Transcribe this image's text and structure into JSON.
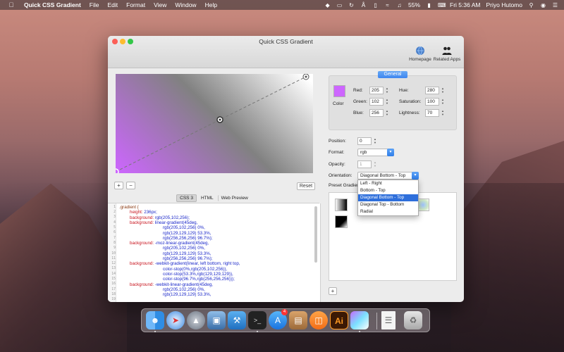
{
  "menubar": {
    "apple_icon": "apple-icon",
    "app_name": "Quick CSS Gradient",
    "menus": [
      "File",
      "Edit",
      "Format",
      "View",
      "Window",
      "Help"
    ],
    "battery": "55%",
    "clock": "Fri 5:36 AM",
    "user": "Priyo Hutomo"
  },
  "window": {
    "title": "Quick CSS Gradient",
    "toolbar": {
      "homepage_label": "Homepage",
      "related_label": "Related Apps"
    }
  },
  "editor": {
    "add_stop": "+",
    "remove_stop": "−",
    "reset": "Reset",
    "tabs": [
      "CSS 3",
      "HTML",
      "Web Preview"
    ],
    "active_tab": "CSS 3",
    "line_numbers": [
      "1",
      "2",
      "3",
      "4",
      "5",
      "6",
      "7",
      "8",
      "9",
      "10",
      "11",
      "12",
      "13",
      "14",
      "15",
      "16",
      "17",
      "18",
      "19"
    ],
    "code": [
      {
        "sel": ".gradient {"
      },
      {
        "prop": "height:",
        "val": " 236px;"
      },
      {
        "prop": "background:",
        "val": " rgb(205,102,256);"
      },
      {
        "prop": "background:",
        "val": " linear-gradient(45deg,"
      },
      {
        "val": "rgb(205,102,256) 0%,"
      },
      {
        "val": "rgb(129,129,129) 53.3%,"
      },
      {
        "val": "rgb(256,256,256) 96.7%);"
      },
      {
        "prop": "background:",
        "val": " -moz-linear-gradient(45deg,"
      },
      {
        "val": "rgb(205,102,256) 0%,"
      },
      {
        "val": "rgb(129,129,129) 53.3%,"
      },
      {
        "val": "rgb(256,256,256) 96.7%);"
      },
      {
        "prop": "background:",
        "val": " -webkit-gradient(linear, left bottom, right top,"
      },
      {
        "val": "color-stop(0%,rgb(205,102,256)),"
      },
      {
        "val": "color-stop(53.3%,rgb(129,129,129)),"
      },
      {
        "val": "color-stop(96.7%,rgb(256,256,256)));"
      },
      {
        "prop": "background:",
        "val": " -webkit-linear-gradient(45deg,"
      },
      {
        "val": "rgb(205,102,256) 0%,"
      },
      {
        "val": "rgb(129,129,129) 53.3%,"
      },
      {
        "val": ""
      }
    ]
  },
  "general": {
    "tab_label": "General",
    "color_label": "Color",
    "swatch_color": "#cd66ff",
    "red_label": "Red:",
    "red": "205",
    "green_label": "Green:",
    "green": "102",
    "blue_label": "Blue:",
    "blue": "256",
    "hue_label": "Hue:",
    "hue": "280",
    "saturation_label": "Saturation:",
    "saturation": "100",
    "lightness_label": "Lightness:",
    "lightness": "70"
  },
  "settings": {
    "position_label": "Position:",
    "position": "0",
    "format_label": "Format:",
    "format": "rgb",
    "opacity_label": "Opacity:",
    "opacity": "1",
    "orientation_label": "Orientation:",
    "orientation": "Diagonal Bottom - Top",
    "orientation_options": [
      "Left - Right",
      "Bottom - Top",
      "Diagonal Bottom - Top",
      "Diagonal Top - Bottom",
      "Radial"
    ],
    "preset_label": "Preset Gradien",
    "add_preset": "+"
  },
  "dock": {
    "apps": [
      "finder-icon",
      "safari-icon",
      "launchpad-icon",
      "preview-icon",
      "xcode-icon",
      "terminal-icon",
      "app-store-icon",
      "books-icon",
      "books-orange-icon",
      "illustrator-icon",
      "quick-css-gradient-icon",
      "document-icon",
      "trash-icon"
    ],
    "app_store_badge": "4",
    "illustrator_label": "Ai"
  }
}
